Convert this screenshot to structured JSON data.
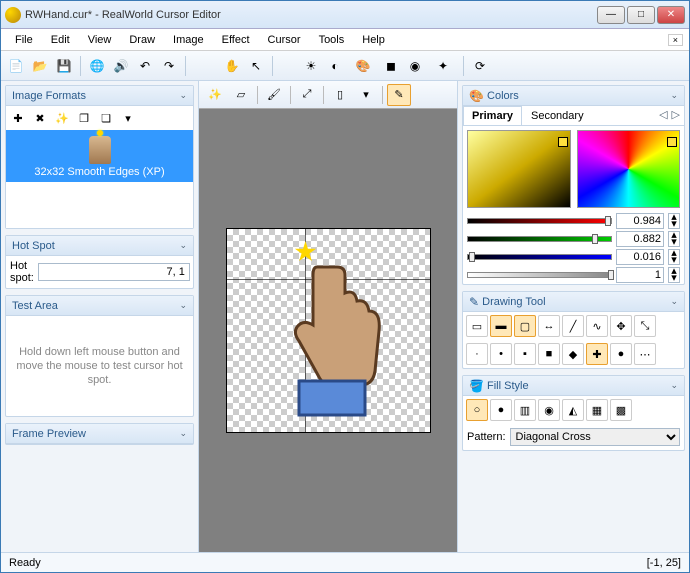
{
  "window": {
    "title": "RWHand.cur* - RealWorld Cursor Editor"
  },
  "menu": [
    "File",
    "Edit",
    "View",
    "Draw",
    "Image",
    "Effect",
    "Cursor",
    "Tools",
    "Help"
  ],
  "panels": {
    "imageFormats": {
      "title": "Image Formats",
      "selected": "32x32 Smooth Edges (XP)"
    },
    "hotSpot": {
      "title": "Hot Spot",
      "label": "Hot spot:",
      "value": "7, 1"
    },
    "testArea": {
      "title": "Test Area",
      "hint": "Hold down left mouse button and move the mouse to test cursor hot spot."
    },
    "framePreview": {
      "title": "Frame Preview"
    },
    "colors": {
      "title": "Colors",
      "tabs": {
        "primary": "Primary",
        "secondary": "Secondary"
      },
      "r": "0.984",
      "g": "0.882",
      "b": "0.016",
      "a": "1"
    },
    "drawingTool": {
      "title": "Drawing Tool"
    },
    "fillStyle": {
      "title": "Fill Style",
      "patternLabel": "Pattern:",
      "patternValue": "Diagonal Cross"
    }
  },
  "status": {
    "ready": "Ready",
    "coord": "[-1, 25]"
  }
}
